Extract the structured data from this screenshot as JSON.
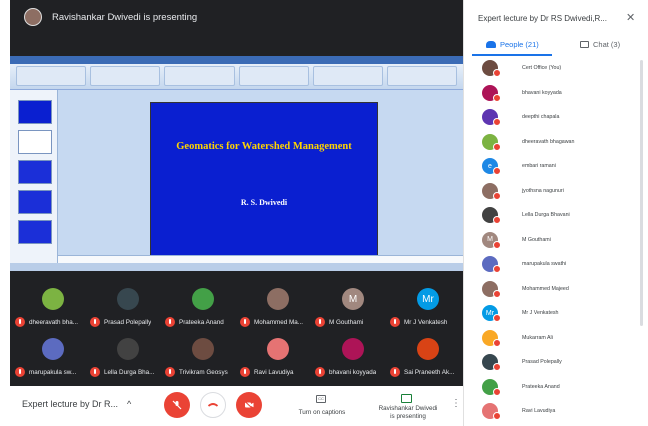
{
  "presenter_banner": "Ravishankar Dwivedi is presenting",
  "slide": {
    "title": "Geomatics for Watershed Management",
    "author": "R. S. Dwivedi"
  },
  "tiles": [
    {
      "name": "dheeravath bha...",
      "color": "#7cb342",
      "initial": ""
    },
    {
      "name": "Prasad Polepally",
      "color": "#37474f",
      "initial": ""
    },
    {
      "name": "Prateeka Anand",
      "color": "#43a047",
      "initial": ""
    },
    {
      "name": "Mohammed Ma...",
      "color": "#8d6e63",
      "initial": ""
    },
    {
      "name": "M Gouthami",
      "color": "#a1887f",
      "initial": "M"
    },
    {
      "name": "Mr J Venkatesh",
      "color": "#039be5",
      "initial": "Mr"
    },
    {
      "name": "marupakula sw...",
      "color": "#5c6bc0",
      "initial": ""
    },
    {
      "name": "Lella Durga Bha...",
      "color": "#424242",
      "initial": ""
    },
    {
      "name": "Trivikram Geosys",
      "color": "#6d4c41",
      "initial": ""
    },
    {
      "name": "Ravi Lavudiya",
      "color": "#e57373",
      "initial": ""
    },
    {
      "name": "bhavani koyyada",
      "color": "#ad1457",
      "initial": ""
    },
    {
      "name": "Sai Praneeth Ak...",
      "color": "#d84315",
      "initial": ""
    }
  ],
  "bottom_bar": {
    "meeting_name": "Expert lecture by Dr R...",
    "captions_label": "Turn on captions",
    "presenting_label_line1": "Ravishankar Dwivedi",
    "presenting_label_line2": "is presenting"
  },
  "panel": {
    "title": "Expert lecture by Dr RS Dwivedi,R...",
    "people_tab": "People (21)",
    "chat_tab": "Chat (3)",
    "participants": [
      {
        "name": "Cert Office (You)",
        "color": "#6d4c41",
        "initial": ""
      },
      {
        "name": "bhavani koyyada",
        "color": "#ad1457",
        "initial": ""
      },
      {
        "name": "deepthi chapala",
        "color": "#5e35b1",
        "initial": ""
      },
      {
        "name": "dheeravath bhagawan",
        "color": "#7cb342",
        "initial": ""
      },
      {
        "name": "embari ramani",
        "color": "#1e88e5",
        "initial": "e"
      },
      {
        "name": "jyothsna nagunuri",
        "color": "#8d6e63",
        "initial": ""
      },
      {
        "name": "Lella Durga Bhavani",
        "color": "#424242",
        "initial": ""
      },
      {
        "name": "M Gouthami",
        "color": "#a1887f",
        "initial": "M"
      },
      {
        "name": "marupakula swathi",
        "color": "#5c6bc0",
        "initial": ""
      },
      {
        "name": "Mohammed Majeed",
        "color": "#8d6e63",
        "initial": ""
      },
      {
        "name": "Mr J Venkatesh",
        "color": "#039be5",
        "initial": "Mr"
      },
      {
        "name": "Mukarram Ali",
        "color": "#f9a825",
        "initial": ""
      },
      {
        "name": "Prasad Polepally",
        "color": "#37474f",
        "initial": ""
      },
      {
        "name": "Prateeka Anand",
        "color": "#43a047",
        "initial": ""
      },
      {
        "name": "Ravi Lavudiya",
        "color": "#e57373",
        "initial": ""
      }
    ]
  },
  "colors": {
    "stage_bg": "#202124",
    "slide_bg": "#0a1fd0",
    "slide_title": "#ffd400",
    "accent": "#1a73e8",
    "danger": "#ea4335"
  }
}
